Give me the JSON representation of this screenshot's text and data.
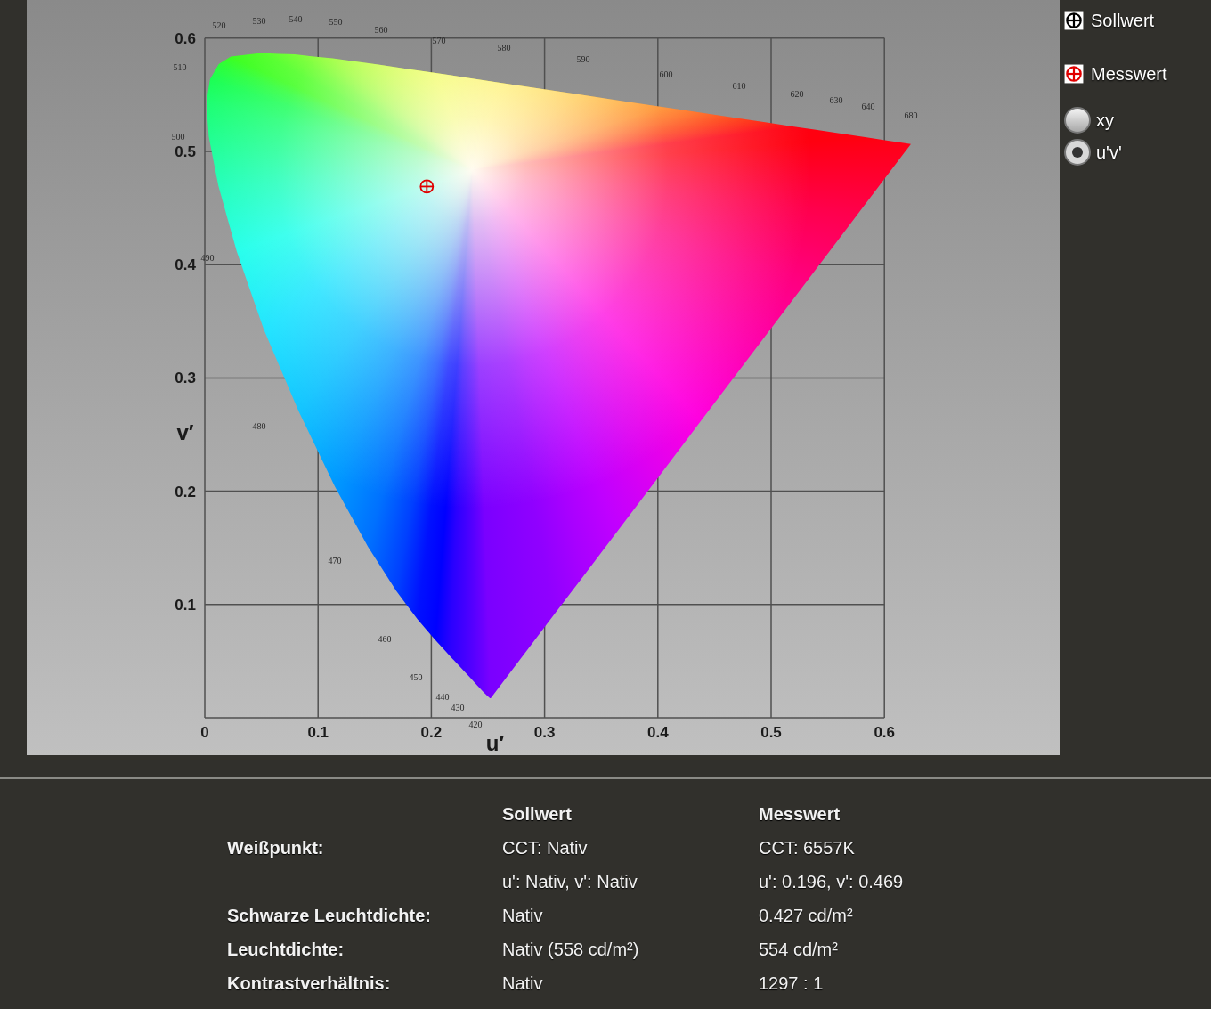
{
  "chart": {
    "chart_data": {
      "type": "scatter",
      "grid": true,
      "xlabel": "u′",
      "ylabel": "v′",
      "xlim": [
        0,
        0.6
      ],
      "ylim": [
        0,
        0.6
      ],
      "xticks": [
        0,
        0.1,
        0.2,
        0.3,
        0.4,
        0.5,
        0.6
      ],
      "yticks": [
        0.1,
        0.2,
        0.3,
        0.4,
        0.5,
        0.6
      ],
      "x": [
        0.196
      ],
      "series": [
        {
          "name": "Messwert",
          "color": "#e00000",
          "values": [
            0.469
          ]
        }
      ]
    },
    "wavelength_labels": [
      "520",
      "530",
      "540",
      "550",
      "560",
      "570",
      "580",
      "590",
      "600",
      "610",
      "620",
      "630",
      "640",
      "680",
      "510",
      "500",
      "490",
      "480",
      "470",
      "460",
      "450",
      "440",
      "430",
      "420"
    ]
  },
  "legend": {
    "markers": [
      {
        "label": "Sollwert",
        "color": "#000000"
      }
    ],
    "coordinate_modes": [
      {
        "label": "xy",
        "selected": false
      },
      {
        "label": "u'v'",
        "selected": true
      }
    ]
  },
  "results": {
    "target_header": "Sollwert",
    "measured_header": "Messwert",
    "rows": [
      {
        "label": "Weißpunkt:",
        "target": "CCT: Nativ",
        "measured": "CCT: 6557K"
      },
      {
        "target": "u': Nativ, v': Nativ",
        "measured": "u': 0.196, v': 0.469"
      },
      {
        "label": "Schwarze Leuchtdichte:",
        "target": "Nativ",
        "measured": "0.427 cd/m²"
      },
      {
        "label": "Leuchtdichte:",
        "target": "Nativ (558 cd/m²)",
        "measured": "554 cd/m²"
      },
      {
        "label": "Kontrastverhältnis:",
        "target": "Nativ",
        "measured": "1297 : 1"
      }
    ]
  }
}
